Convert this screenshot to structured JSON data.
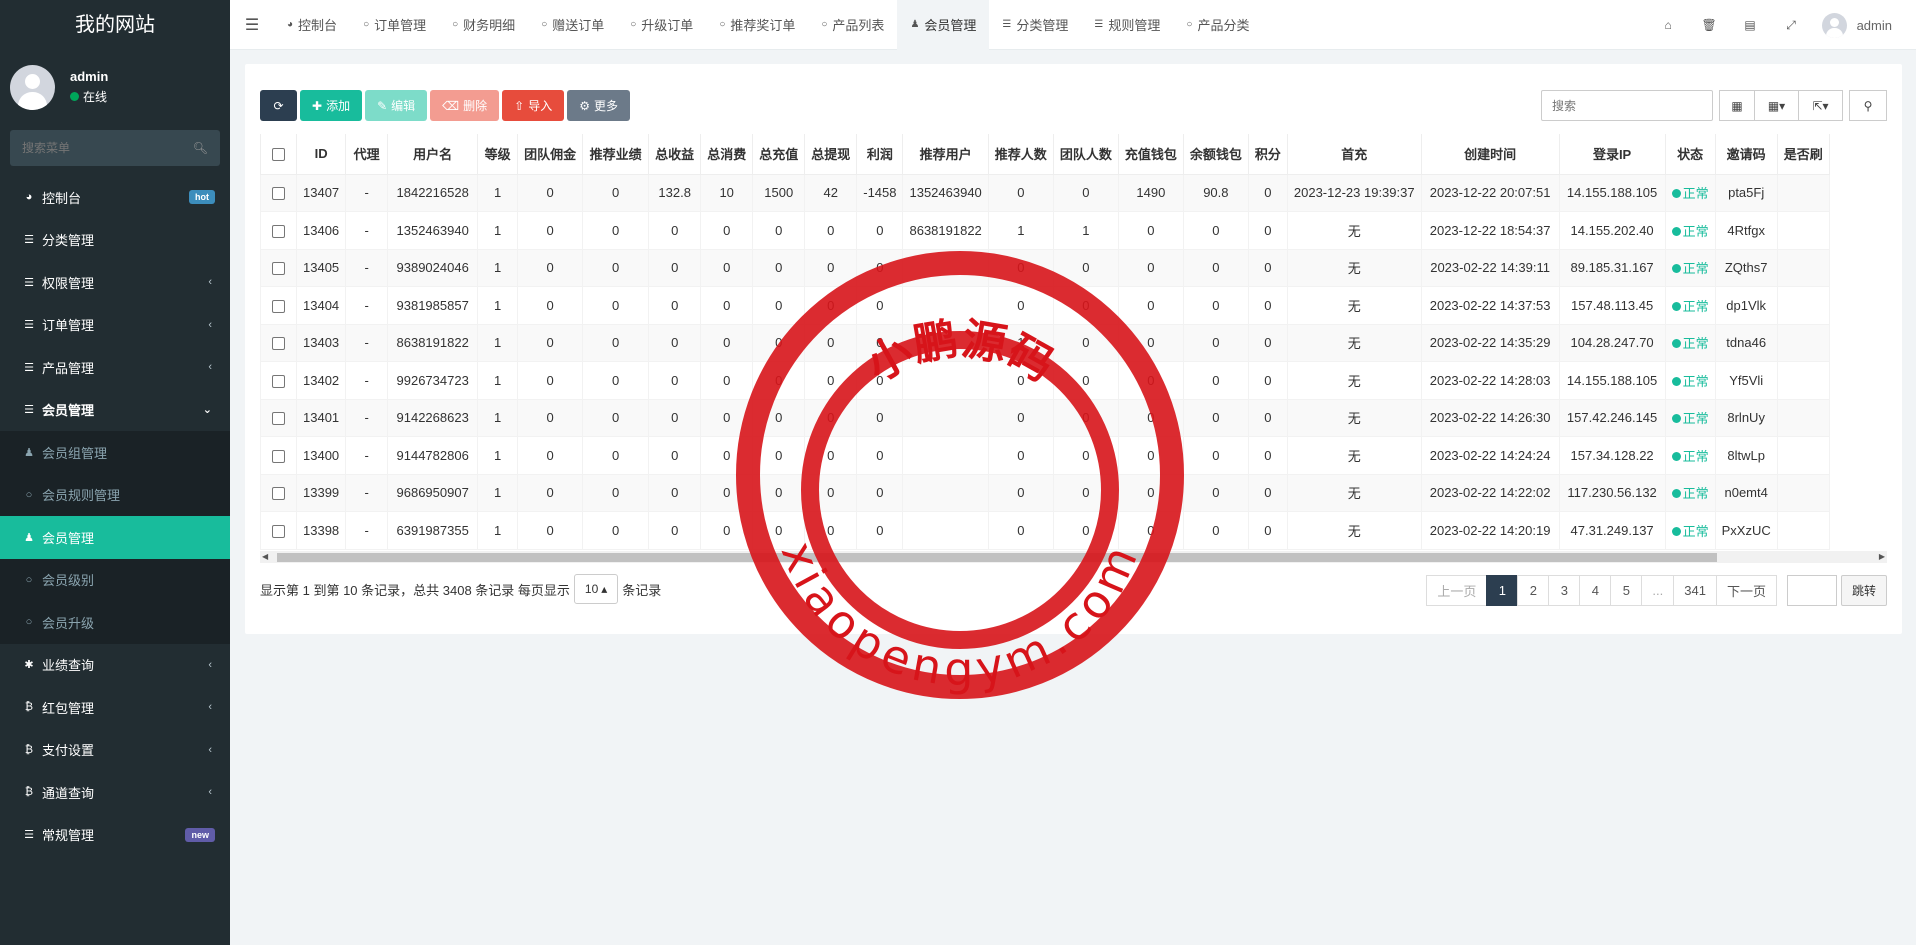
{
  "brand": "我的网站",
  "user": {
    "name": "admin",
    "status": "在线"
  },
  "sidebar": {
    "search_placeholder": "搜索菜单",
    "items": [
      {
        "label": "控制台",
        "icon": "dashboard-icon",
        "badge": "hot"
      },
      {
        "label": "分类管理",
        "icon": "list-icon"
      },
      {
        "label": "权限管理",
        "icon": "list-icon"
      },
      {
        "label": "订单管理",
        "icon": "list-icon"
      },
      {
        "label": "产品管理",
        "icon": "list-icon"
      },
      {
        "label": "会员管理",
        "icon": "list-icon"
      }
    ],
    "submenu": [
      {
        "label": "会员组管理",
        "icon": "users-icon"
      },
      {
        "label": "会员规则管理",
        "icon": "circle-icon"
      },
      {
        "label": "会员管理",
        "icon": "user-icon"
      },
      {
        "label": "会员级别",
        "icon": "circle-icon"
      },
      {
        "label": "会员升级",
        "icon": "circle-icon"
      }
    ],
    "items2": [
      {
        "label": "业绩查询",
        "icon": "asterisk-icon"
      },
      {
        "label": "红包管理",
        "icon": "bitcoin-icon"
      },
      {
        "label": "支付设置",
        "icon": "bitcoin-icon"
      },
      {
        "label": "通道查询",
        "icon": "bitcoin-icon"
      },
      {
        "label": "常规管理",
        "icon": "list-icon",
        "badge": "new"
      }
    ]
  },
  "tabs": [
    "控制台",
    "订单管理",
    "财务明细",
    "赠送订单",
    "升级订单",
    "推荐奖订单",
    "产品列表",
    "会员管理",
    "分类管理",
    "规则管理",
    "产品分类"
  ],
  "nav_user": "admin",
  "toolbar": {
    "add": "添加",
    "edit": "编辑",
    "delete": "删除",
    "import": "导入",
    "more": "更多"
  },
  "search_placeholder": "搜索",
  "table": {
    "headers": [
      "ID",
      "代理",
      "用户名",
      "等级",
      "团队佣金",
      "推荐业绩",
      "总收益",
      "总消费",
      "总充值",
      "总提现",
      "利润",
      "推荐用户",
      "推荐人数",
      "团队人数",
      "充值钱包",
      "余额钱包",
      "积分",
      "首充",
      "创建时间",
      "登录IP",
      "状态",
      "邀请码",
      "是否刷"
    ],
    "rows": [
      [
        "13407",
        "-",
        "1842216528",
        "1",
        "0",
        "0",
        "132.8",
        "10",
        "1500",
        "42",
        "-1458",
        "1352463940",
        "0",
        "0",
        "1490",
        "90.8",
        "0",
        "2023-12-23 19:39:37",
        "2023-12-22 20:07:51",
        "14.155.188.105",
        "正常",
        "pta5Fj",
        ""
      ],
      [
        "13406",
        "-",
        "1352463940",
        "1",
        "0",
        "0",
        "0",
        "0",
        "0",
        "0",
        "0",
        "8638191822",
        "1",
        "1",
        "0",
        "0",
        "0",
        "无",
        "2023-12-22 18:54:37",
        "14.155.202.40",
        "正常",
        "4Rtfgx",
        ""
      ],
      [
        "13405",
        "-",
        "9389024046",
        "1",
        "0",
        "0",
        "0",
        "0",
        "0",
        "0",
        "0",
        "",
        "0",
        "0",
        "0",
        "0",
        "0",
        "无",
        "2023-02-22 14:39:11",
        "89.185.31.167",
        "正常",
        "ZQths7",
        ""
      ],
      [
        "13404",
        "-",
        "9381985857",
        "1",
        "0",
        "0",
        "0",
        "0",
        "0",
        "0",
        "0",
        "",
        "0",
        "0",
        "0",
        "0",
        "0",
        "无",
        "2023-02-22 14:37:53",
        "157.48.113.45",
        "正常",
        "dp1Vlk",
        ""
      ],
      [
        "13403",
        "-",
        "8638191822",
        "1",
        "0",
        "0",
        "0",
        "0",
        "0",
        "0",
        "0",
        "",
        "1",
        "0",
        "0",
        "0",
        "0",
        "无",
        "2023-02-22 14:35:29",
        "104.28.247.70",
        "正常",
        "tdna46",
        ""
      ],
      [
        "13402",
        "-",
        "9926734723",
        "1",
        "0",
        "0",
        "0",
        "0",
        "0",
        "0",
        "0",
        "",
        "0",
        "0",
        "0",
        "0",
        "0",
        "无",
        "2023-02-22 14:28:03",
        "14.155.188.105",
        "正常",
        "Yf5Vli",
        ""
      ],
      [
        "13401",
        "-",
        "9142268623",
        "1",
        "0",
        "0",
        "0",
        "0",
        "0",
        "0",
        "0",
        "",
        "0",
        "0",
        "0",
        "0",
        "0",
        "无",
        "2023-02-22 14:26:30",
        "157.42.246.145",
        "正常",
        "8rlnUy",
        ""
      ],
      [
        "13400",
        "-",
        "9144782806",
        "1",
        "0",
        "0",
        "0",
        "0",
        "0",
        "0",
        "0",
        "",
        "0",
        "0",
        "0",
        "0",
        "0",
        "无",
        "2023-02-22 14:24:24",
        "157.34.128.22",
        "正常",
        "8ltwLp",
        ""
      ],
      [
        "13399",
        "-",
        "9686950907",
        "1",
        "0",
        "0",
        "0",
        "0",
        "0",
        "0",
        "0",
        "",
        "0",
        "0",
        "0",
        "0",
        "0",
        "无",
        "2023-02-22 14:22:02",
        "117.230.56.132",
        "正常",
        "n0emt4",
        ""
      ],
      [
        "13398",
        "-",
        "6391987355",
        "1",
        "0",
        "0",
        "0",
        "0",
        "0",
        "0",
        "0",
        "",
        "0",
        "0",
        "0",
        "0",
        "0",
        "无",
        "2023-02-22 14:20:19",
        "47.31.249.137",
        "正常",
        "PxXzUC",
        ""
      ]
    ]
  },
  "footer": {
    "info": "显示第 1 到第 10 条记录，总共 3408 条记录 每页显示",
    "page_size": "10",
    "suffix": "条记录"
  },
  "pagination": {
    "prev": "上一页",
    "pages": [
      "1",
      "2",
      "3",
      "4",
      "5",
      "...",
      "341"
    ],
    "next": "下一页",
    "jump": "跳转"
  },
  "watermark": {
    "cn": "小鹏源码",
    "en": "xiaopengym.com"
  },
  "colors": {
    "sidebar": "#222d32",
    "accent": "#18bc9c",
    "dark": "#2c3e50",
    "danger": "#e74c3c",
    "stamp": "#d7141a"
  }
}
